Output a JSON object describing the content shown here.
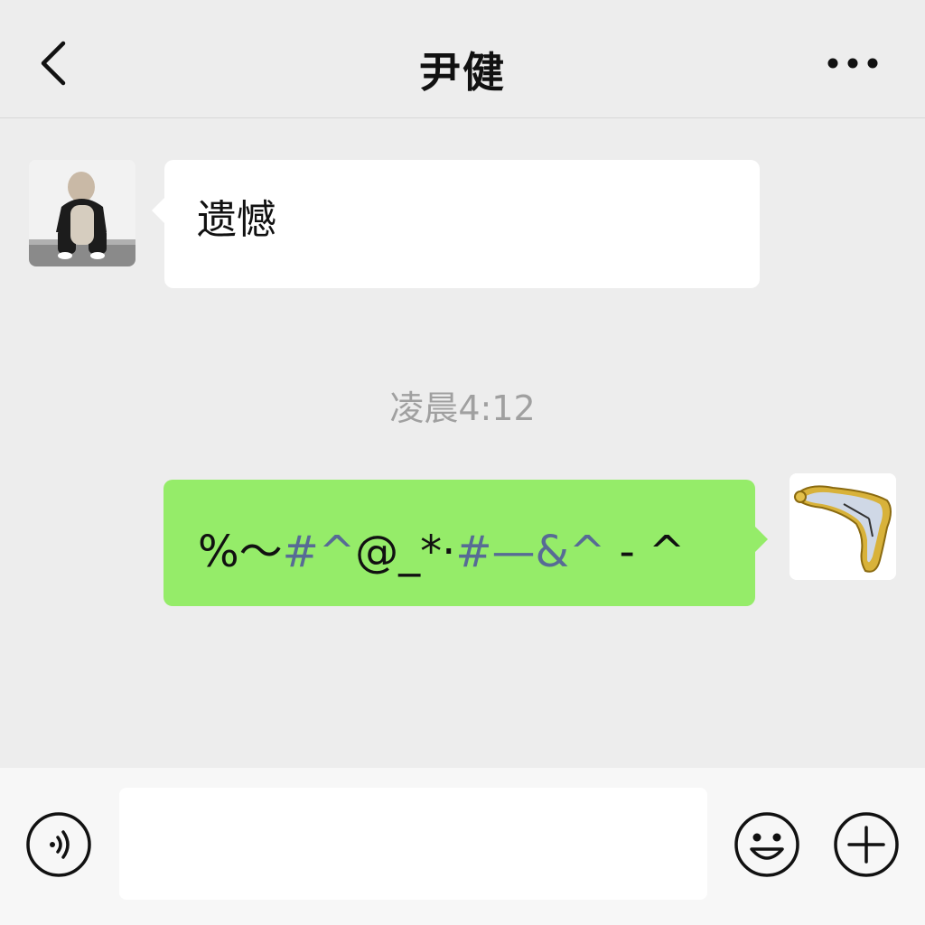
{
  "header": {
    "title": "尹健",
    "back_icon": "chevron-left-icon",
    "more_icon": "more-dots-icon"
  },
  "messages": [
    {
      "direction": "incoming",
      "text": "遗憾",
      "avatar": "cat-person-photo"
    },
    {
      "direction": "outgoing",
      "segments": [
        {
          "text": "%～",
          "color": "#111111"
        },
        {
          "text": "#^",
          "color": "#576b95"
        },
        {
          "text": "@_*·",
          "color": "#111111"
        },
        {
          "text": "#—&^",
          "color": "#576b95"
        },
        {
          "text": " - ^",
          "color": "#111111"
        }
      ],
      "avatar": "melting-clock-image"
    }
  ],
  "timestamp": "凌晨4:12",
  "input_bar": {
    "voice_icon": "voice-icon",
    "input_value": "",
    "emoji_icon": "emoji-icon",
    "plus_icon": "plus-icon"
  },
  "colors": {
    "background": "#ededed",
    "outgoing_bubble": "#95ec69",
    "incoming_bubble": "#ffffff",
    "link_blue": "#576b95"
  }
}
